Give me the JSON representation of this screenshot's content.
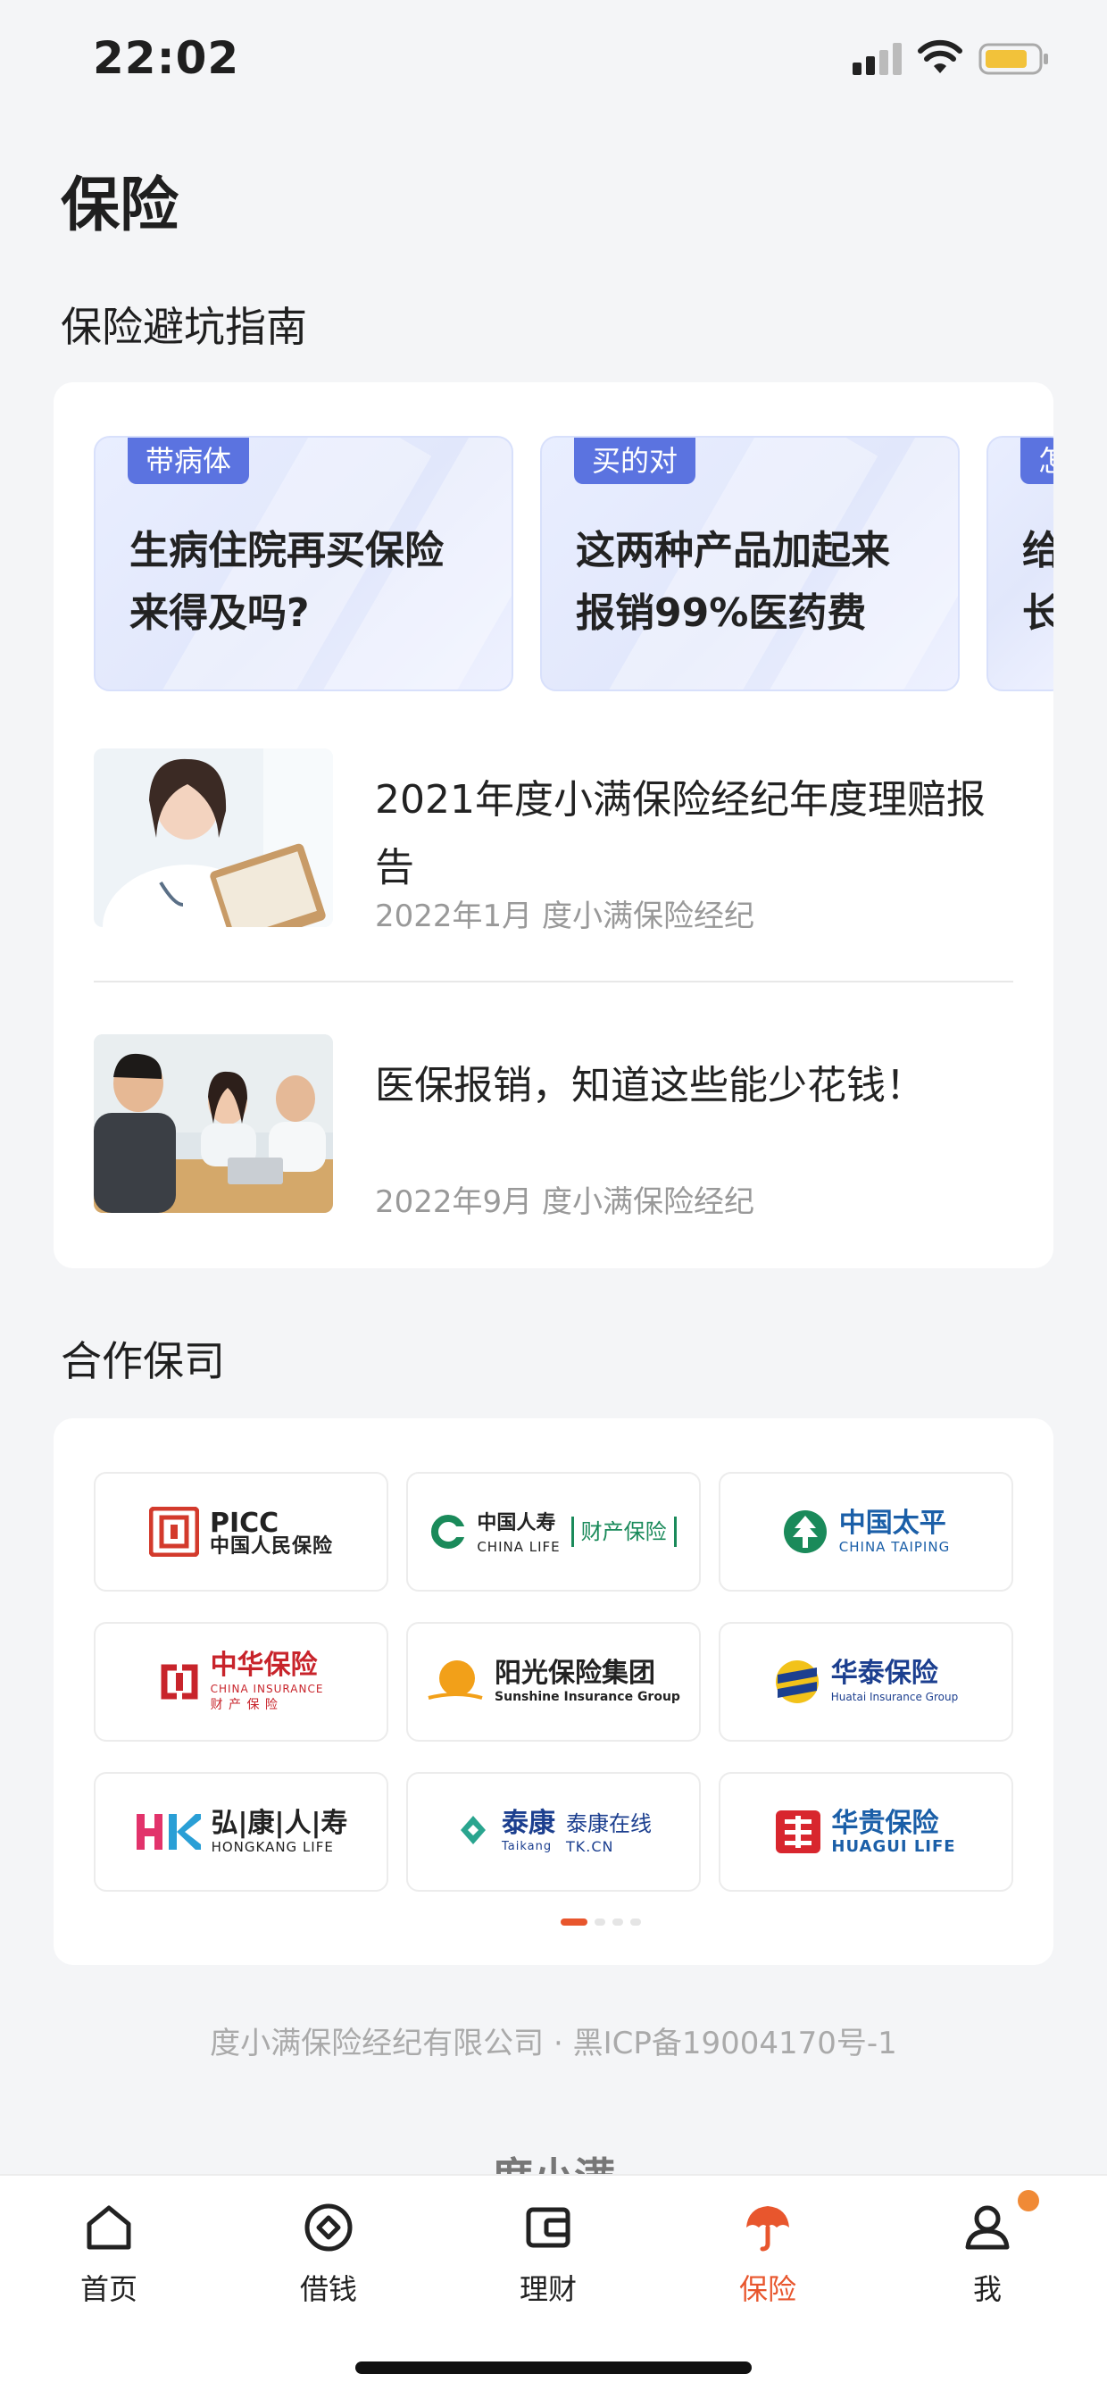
{
  "status": {
    "time": "22:02"
  },
  "page": {
    "title": "保险"
  },
  "guides": {
    "section_title": "保险避坑指南",
    "cards": [
      {
        "tag": "带病体",
        "text": "生病住院再买保险\n来得及吗?"
      },
      {
        "tag": "买的对",
        "text": "这两种产品加起来\n报销99%医药费"
      },
      {
        "tag": "怎",
        "text": "给\n长"
      }
    ],
    "articles": [
      {
        "title": "2021年度小满保险经纪年度理赔报告",
        "meta": "2022年1月  度小满保险经纪",
        "thumb": "doctor-photo"
      },
      {
        "title": "医保报销，知道这些能少花钱！",
        "meta": "2022年9月  度小满保险经纪",
        "thumb": "meeting-photo"
      }
    ]
  },
  "partners": {
    "section_title": "合作保司",
    "logos": [
      {
        "main": "PICC",
        "sub": "中国人民保险",
        "color": "#d33a2c"
      },
      {
        "main": "中国人寿",
        "sub": "CHINA LIFE",
        "extra": "财产保险",
        "color": "#1a8a5a"
      },
      {
        "main": "中国太平",
        "sub": "CHINA TAIPING",
        "color": "#1b5fa8"
      },
      {
        "main": "中华保险",
        "sub": "CHINA INSURANCE",
        "extra": "财 产 保 险",
        "color": "#c8242b"
      },
      {
        "main": "阳光保险集团",
        "sub": "Sunshine Insurance Group",
        "color": "#222222"
      },
      {
        "main": "华泰保险",
        "sub": "Huatai Insurance Group",
        "color": "#1c3f8f"
      },
      {
        "main": "弘|康|人|寿",
        "sub": "HONGKANG LIFE",
        "color": "#222222"
      },
      {
        "main": "泰康",
        "sub": "Taikang",
        "extra": "泰康在线",
        "extra_sub": "TK.CN",
        "color": "#1c3f8f"
      },
      {
        "main": "华贵保险",
        "sub": "HUAGUI LIFE",
        "color": "#1b5fa8"
      }
    ],
    "page_indicator": {
      "pages": 4,
      "current": 1
    }
  },
  "footer": {
    "text": "度小满保险经纪有限公司 · 黑ICP备19004170号-1",
    "brand": "度小满"
  },
  "tabbar": {
    "items": [
      {
        "label": "首页",
        "icon": "home-icon"
      },
      {
        "label": "借钱",
        "icon": "loan-icon"
      },
      {
        "label": "理财",
        "icon": "wallet-icon"
      },
      {
        "label": "保险",
        "icon": "umbrella-icon",
        "active": true
      },
      {
        "label": "我",
        "icon": "user-icon",
        "badge": true
      }
    ]
  },
  "colors": {
    "accent": "#e8562d",
    "tag_blue": "#5b73e0",
    "badge": "#f08a36"
  }
}
